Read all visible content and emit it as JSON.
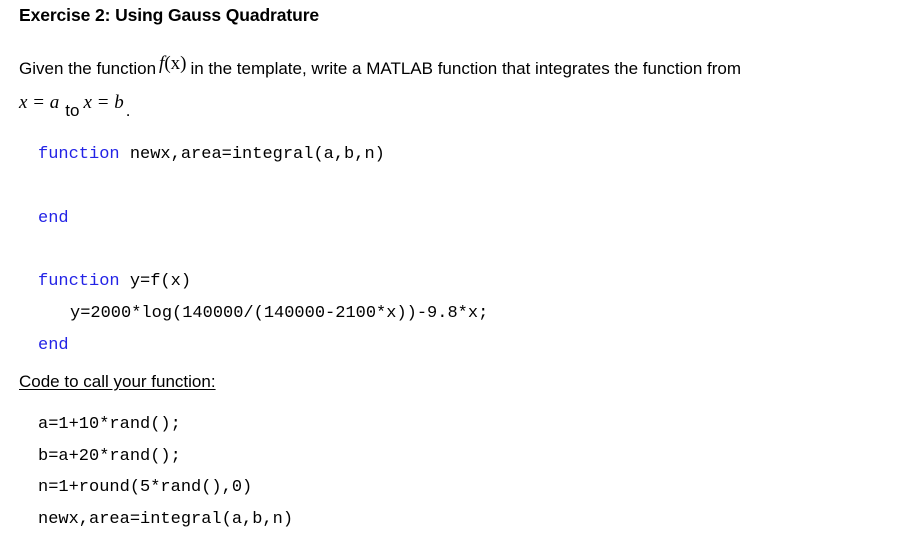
{
  "title": "Exercise 2: Using Gauss Quadrature",
  "instructions": {
    "line1_before": "Given the function",
    "fx_func": "f",
    "fx_arg": "(x)",
    "line1_after": "in the template, write a MATLAB function that integrates the function from",
    "from_expr": "x = a",
    "to_word": "to",
    "to_expr": "x = b",
    "end_punct": "."
  },
  "template_code": {
    "main_function": {
      "keyword": "function",
      "signature": " newx,area=integral(a,b,n)",
      "end_keyword": "end"
    },
    "helper_function": {
      "keyword": "function",
      "signature": " y=f(x)",
      "body": "y=2000*log(140000/(140000-2100*x))-9.8*x;",
      "end_keyword": "end"
    }
  },
  "call_section": {
    "heading": "Code to call your function:",
    "lines": [
      "a=1+10*rand();",
      "b=a+20*rand();",
      "n=1+round(5*rand(),0)",
      "newx,area=integral(a,b,n)"
    ]
  },
  "colors": {
    "keyword": "#2323e6",
    "text": "#000000",
    "background": "#ffffff"
  }
}
